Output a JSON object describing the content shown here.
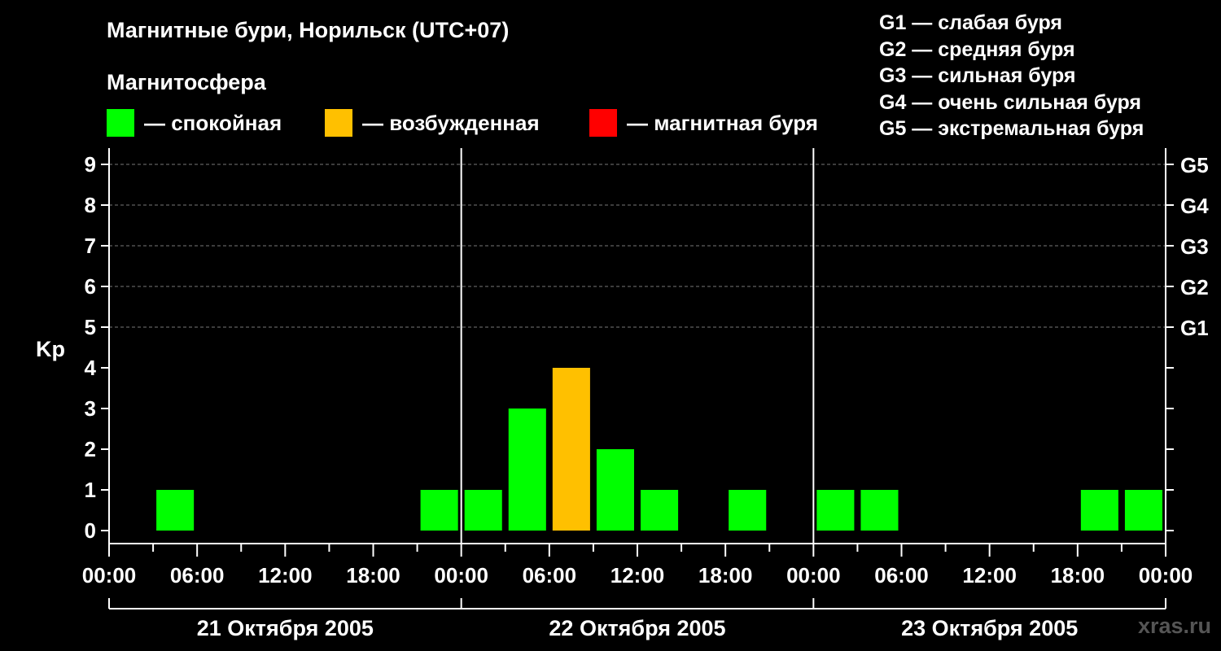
{
  "header": {
    "title": "Магнитные бури, Норильск (UTC+07)",
    "subtitle": "Магнитосфера",
    "legend": [
      {
        "label": "— спокойная",
        "color": "#00ff00"
      },
      {
        "label": "— возбужденная",
        "color": "#ffc000"
      },
      {
        "label": "— магнитная буря",
        "color": "#ff0000"
      }
    ],
    "storm_levels": [
      "G1 — слабая буря",
      "G2 — средняя буря",
      "G3 — сильная буря",
      "G4 — очень сильная буря",
      "G5 — экстремальная буря"
    ]
  },
  "credit": "xras.ru",
  "chart_data": {
    "type": "bar",
    "ylabel": "Kp",
    "ylim": [
      0,
      9
    ],
    "yticks": [
      "0",
      "1",
      "2",
      "3",
      "4",
      "5",
      "6",
      "7",
      "8",
      "9"
    ],
    "right_ticks": [
      {
        "kp": 5,
        "label": "G1"
      },
      {
        "kp": 6,
        "label": "G2"
      },
      {
        "kp": 7,
        "label": "G3"
      },
      {
        "kp": 8,
        "label": "G4"
      },
      {
        "kp": 9,
        "label": "G5"
      }
    ],
    "grid": "dashed horizontal at Kp 5–9",
    "xtick_labels": [
      "00:00",
      "06:00",
      "12:00",
      "18:00",
      "00:00",
      "06:00",
      "12:00",
      "18:00",
      "00:00",
      "06:00",
      "12:00",
      "18:00",
      "00:00"
    ],
    "days": [
      "21 Октября 2005",
      "22 Октября 2005",
      "23 Октября 2005"
    ],
    "categories": [
      "21.10 00:00",
      "21.10 03:00",
      "21.10 06:00",
      "21.10 09:00",
      "21.10 12:00",
      "21.10 15:00",
      "21.10 18:00",
      "21.10 21:00",
      "22.10 00:00",
      "22.10 03:00",
      "22.10 06:00",
      "22.10 09:00",
      "22.10 12:00",
      "22.10 15:00",
      "22.10 18:00",
      "22.10 21:00",
      "23.10 00:00",
      "23.10 03:00",
      "23.10 06:00",
      "23.10 09:00",
      "23.10 12:00",
      "23.10 15:00",
      "23.10 18:00",
      "23.10 21:00"
    ],
    "bars": [
      {
        "slot": 1,
        "kp": 1,
        "color": "#00ff00"
      },
      {
        "slot": 7,
        "kp": 1,
        "color": "#00ff00"
      },
      {
        "slot": 8,
        "kp": 1,
        "color": "#00ff00"
      },
      {
        "slot": 9,
        "kp": 3,
        "color": "#00ff00"
      },
      {
        "slot": 10,
        "kp": 4,
        "color": "#ffc000"
      },
      {
        "slot": 11,
        "kp": 2,
        "color": "#00ff00"
      },
      {
        "slot": 12,
        "kp": 1,
        "color": "#00ff00"
      },
      {
        "slot": 14,
        "kp": 1,
        "color": "#00ff00"
      },
      {
        "slot": 16,
        "kp": 1,
        "color": "#00ff00"
      },
      {
        "slot": 17,
        "kp": 1,
        "color": "#00ff00"
      },
      {
        "slot": 22,
        "kp": 1,
        "color": "#00ff00"
      },
      {
        "slot": 23,
        "kp": 1,
        "color": "#00ff00"
      }
    ]
  }
}
